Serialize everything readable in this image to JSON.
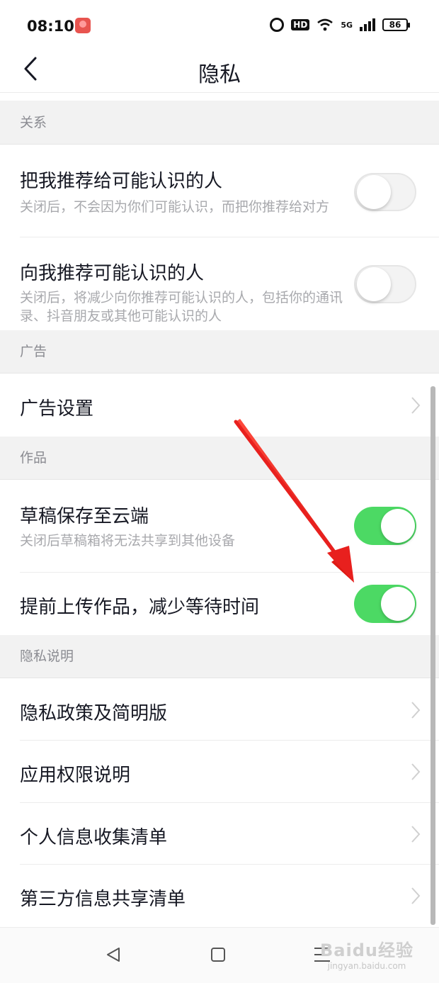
{
  "status_bar": {
    "time": "08:10",
    "hd_label": "HD",
    "network_label": "5G",
    "battery": "86"
  },
  "nav": {
    "title": "隐私",
    "back_icon": "chevron-left-icon"
  },
  "sections": {
    "relationship": {
      "header": "关系"
    },
    "ads": {
      "header": "广告"
    },
    "works": {
      "header": "作品"
    },
    "privacy_info": {
      "header": "隐私说明"
    }
  },
  "rows": {
    "recommend_me": {
      "title": "把我推荐给可能认识的人",
      "desc": "关闭后，不会因为你们可能认识，而把你推荐给对方",
      "enabled": false
    },
    "recommend_to_me": {
      "title": "向我推荐可能认识的人",
      "desc": "关闭后，将减少向你推荐可能认识的人，包括你的通讯录、抖音朋友或其他可能认识的人",
      "enabled": false
    },
    "ad_settings": {
      "title": "广告设置"
    },
    "draft_cloud": {
      "title": "草稿保存至云端",
      "desc": "关闭后草稿箱将无法共享到其他设备",
      "enabled": true
    },
    "pre_upload": {
      "title": "提前上传作品，减少等待时间",
      "enabled": true
    },
    "privacy_policy": {
      "title": "隐私政策及简明版"
    },
    "app_permissions": {
      "title": "应用权限说明"
    },
    "personal_info_list": {
      "title": "个人信息收集清单"
    },
    "third_party_list": {
      "title": "第三方信息共享清单"
    }
  },
  "colors": {
    "toggle_on": "#4cd964",
    "toggle_off": "#f3f3f3",
    "section_bg": "#f2f2f2",
    "annotation_arrow": "#e8201e"
  },
  "watermark": {
    "brand": "Baidu经验",
    "url": "jingyan.baidu.com"
  }
}
